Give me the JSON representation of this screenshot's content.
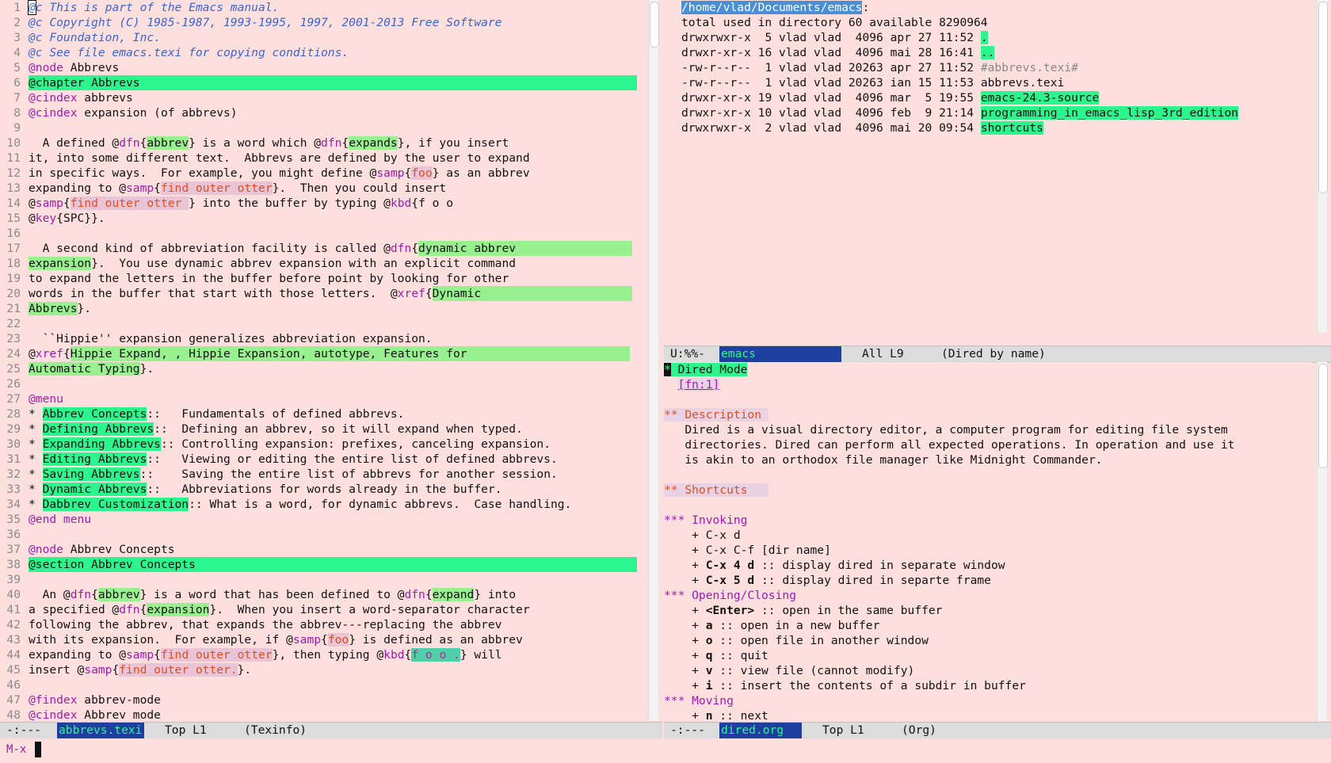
{
  "left": {
    "modeline": {
      "status": "-:---",
      "buffer": "abbrevs.texi",
      "pos": "Top L1",
      "mode": "(Texinfo)"
    }
  },
  "right_top": {
    "path": "/home/vlad/Documents/emacs",
    "total": "total used in directory 60 available 8290964",
    "rows": [
      {
        "perm": "drwxrwxr-x",
        "n": " 5",
        "date": "apr 27 11:52",
        "name": "."
      },
      {
        "perm": "drwxr-xr-x",
        "n": "16",
        "date": "mai 28 16:41",
        "name": ".."
      },
      {
        "perm": "-rw-r--r--",
        "n": " 1",
        "date": "apr 27 11:52",
        "name": "#abbrevs.texi#"
      },
      {
        "perm": "-rw-r--r--",
        "n": " 1",
        "date": "ian 15 11:53",
        "name": "abbrevs.texi"
      },
      {
        "perm": "drwxr-xr-x",
        "n": "19",
        "date": "mar  5 19:55",
        "name": "emacs-24.3-source"
      },
      {
        "perm": "drwxr-xr-x",
        "n": "10",
        "date": "feb  9 21:14",
        "name": "programming_in_emacs_lisp_3rd_edition"
      },
      {
        "perm": "drwxrwxr-x",
        "n": " 2",
        "date": "mai 20 09:54",
        "name": "shortcuts"
      }
    ],
    "modeline": {
      "status": "U:%%-",
      "buffer": "emacs",
      "pos": "All L9",
      "mode": "(Dired by name)"
    }
  },
  "right_bottom": {
    "modeline": {
      "status": "-:---",
      "buffer": "dired.org",
      "pos": "Top L1",
      "mode": "(Org)"
    }
  },
  "minibuffer": {
    "prompt": "M-x"
  }
}
